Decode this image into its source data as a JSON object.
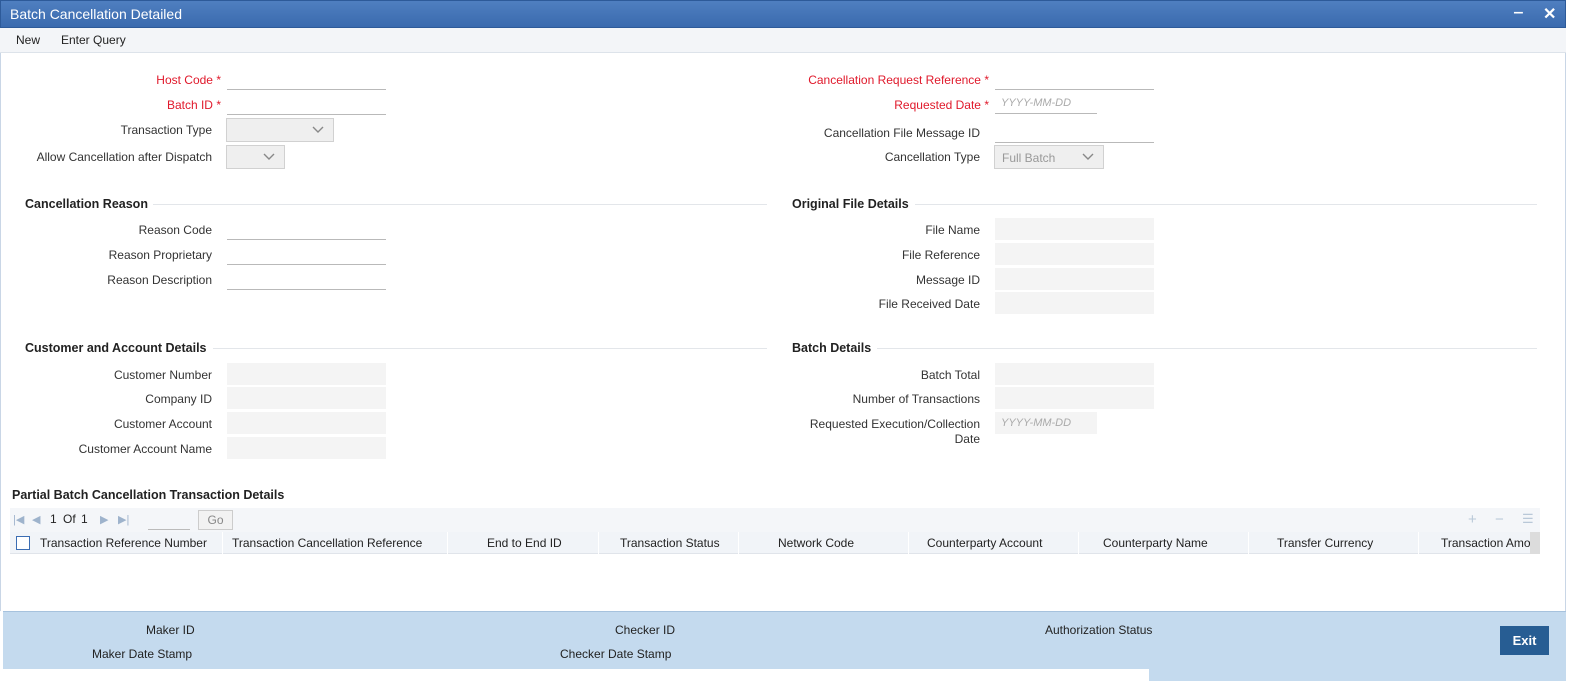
{
  "window": {
    "title": "Batch Cancellation Detailed",
    "minimize_glyph": "‒",
    "close_glyph": "✕"
  },
  "menu": {
    "new": "New",
    "enter_query": "Enter Query"
  },
  "header_left": {
    "host_code": {
      "label": "Host Code",
      "required_mark": "*",
      "value": ""
    },
    "batch_id": {
      "label": "Batch ID",
      "required_mark": "*",
      "value": ""
    },
    "transaction_type": {
      "label": "Transaction Type",
      "value": ""
    },
    "allow_cancellation": {
      "label": "Allow Cancellation after Dispatch",
      "value": ""
    }
  },
  "header_right": {
    "cancellation_request_reference": {
      "label": "Cancellation Request Reference",
      "required_mark": "*",
      "value": ""
    },
    "requested_date": {
      "label": "Requested Date",
      "required_mark": "*",
      "placeholder": "YYYY-MM-DD"
    },
    "cancellation_file_message_id": {
      "label": "Cancellation File Message ID",
      "value": ""
    },
    "cancellation_type": {
      "label": "Cancellation Type",
      "value": "Full Batch"
    }
  },
  "cancellation_reason": {
    "title": "Cancellation Reason",
    "reason_code": "Reason Code",
    "reason_proprietary": "Reason Proprietary",
    "reason_description": "Reason Description"
  },
  "original_file_details": {
    "title": "Original File Details",
    "file_name": "File Name",
    "file_reference": "File Reference",
    "message_id": "Message ID",
    "file_received_date": "File Received Date"
  },
  "customer_account_details": {
    "title": "Customer and Account Details",
    "customer_number": "Customer Number",
    "company_id": "Company ID",
    "customer_account": "Customer Account",
    "customer_account_name": "Customer Account Name"
  },
  "batch_details": {
    "title": "Batch Details",
    "batch_total": "Batch Total",
    "number_of_transactions": "Number of Transactions",
    "requested_execution_line1": "Requested Execution/Collection",
    "requested_execution_line2": "Date",
    "date_placeholder": "YYYY-MM-DD"
  },
  "grid": {
    "title": "Partial Batch Cancellation Transaction Details",
    "page_current": "1",
    "page_of": "Of",
    "page_total": "1",
    "go_label": "Go",
    "columns": [
      "Transaction Reference Number",
      "Transaction Cancellation Reference",
      "End to End ID",
      "Transaction Status",
      "Network Code",
      "Counterparty Account",
      "Counterparty Name",
      "Transfer Currency",
      "Transaction Amo"
    ]
  },
  "footer": {
    "maker_id": "Maker ID",
    "maker_date_stamp": "Maker Date Stamp",
    "checker_id": "Checker ID",
    "checker_date_stamp": "Checker Date Stamp",
    "authorization_status": "Authorization Status",
    "exit_label": "Exit"
  }
}
